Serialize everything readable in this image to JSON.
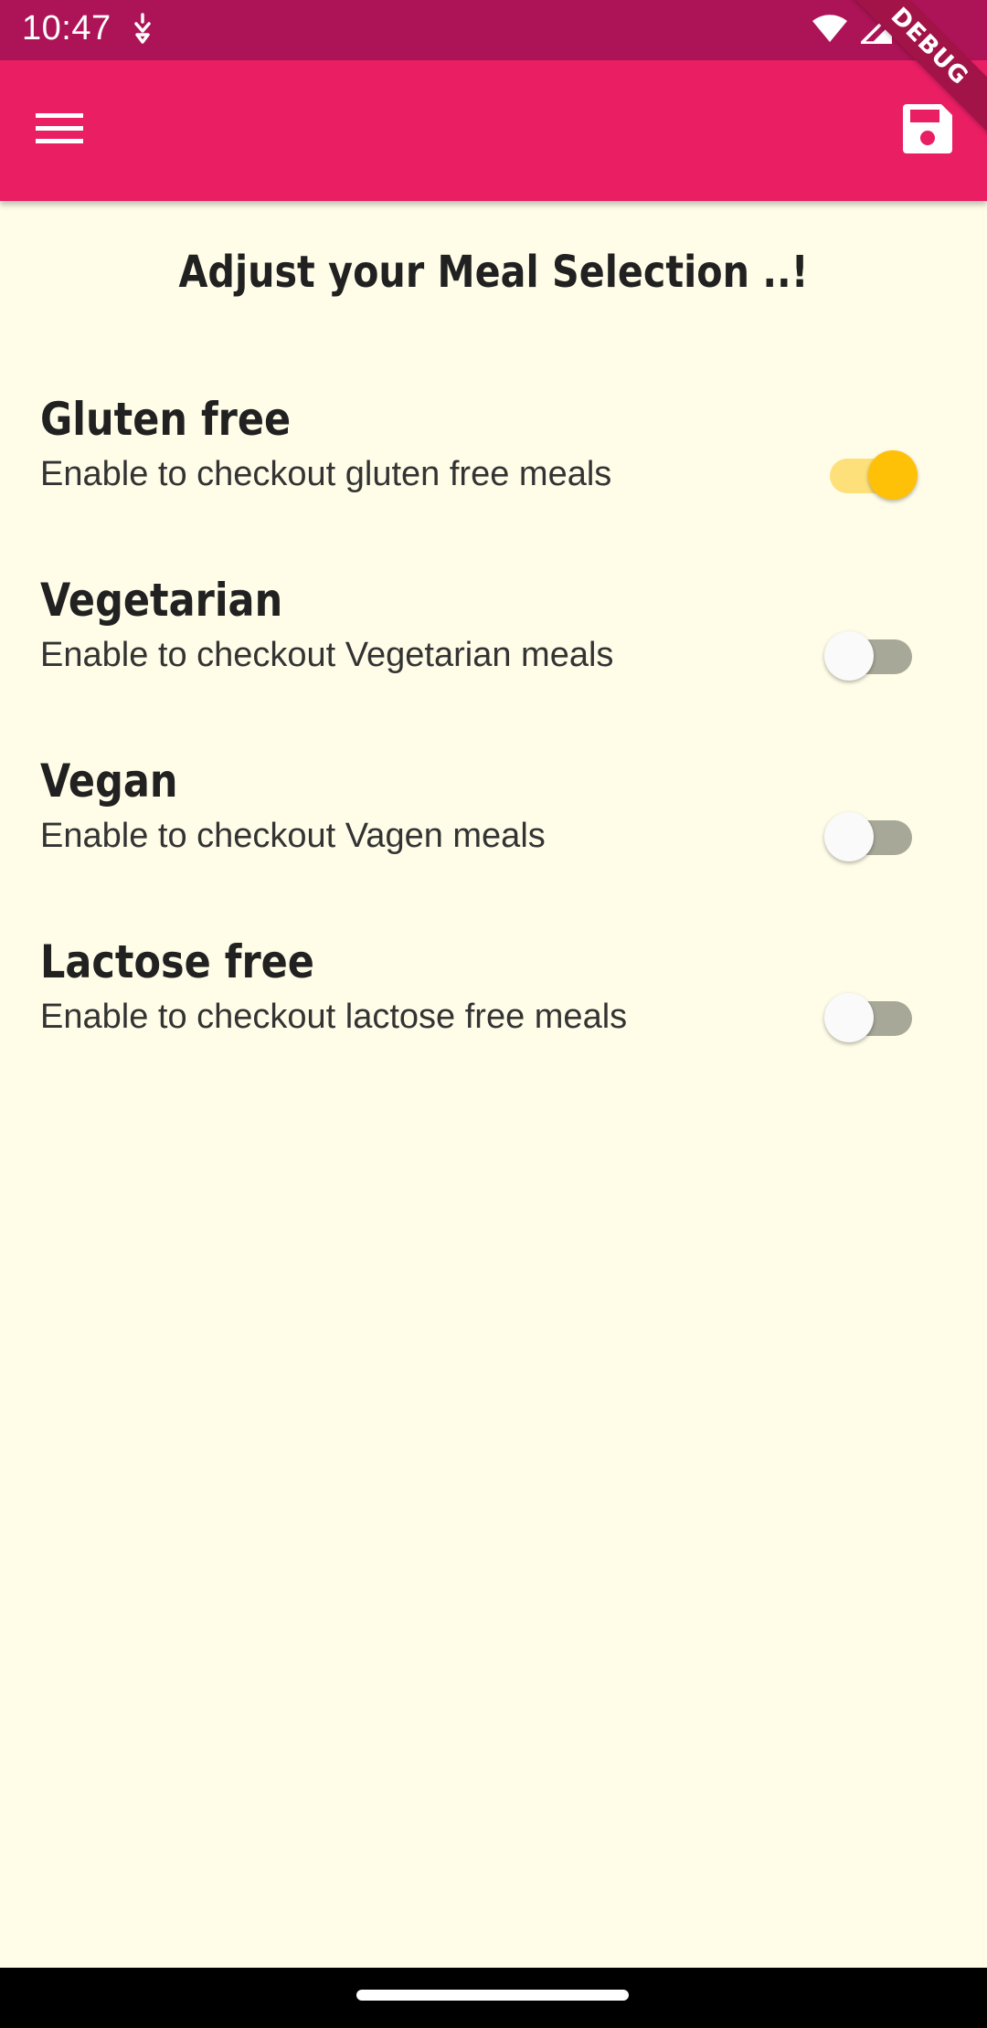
{
  "status_bar": {
    "time": "10:47",
    "icons": [
      "notification-icon",
      "wifi-icon",
      "signal-icon",
      "battery-icon"
    ]
  },
  "app_bar": {
    "menu_icon": "menu-icon",
    "save_icon": "save-icon",
    "debug_label": "DEBUG",
    "color": "#e91e63"
  },
  "page": {
    "title": "Adjust your Meal Selection ..!"
  },
  "options": [
    {
      "title": "Gluten free",
      "subtitle": "Enable to checkout gluten free meals",
      "enabled": true
    },
    {
      "title": "Vegetarian",
      "subtitle": "Enable to checkout Vegetarian meals",
      "enabled": false
    },
    {
      "title": "Vegan",
      "subtitle": "Enable to checkout Vagen meals",
      "enabled": false
    },
    {
      "title": "Lactose free",
      "subtitle": "Enable to checkout lactose free meals",
      "enabled": false
    }
  ],
  "colors": {
    "background": "#fffde8",
    "switch_on_thumb": "#ffc107",
    "switch_on_track": "#fde07a",
    "status_bar": "#ad1457"
  }
}
